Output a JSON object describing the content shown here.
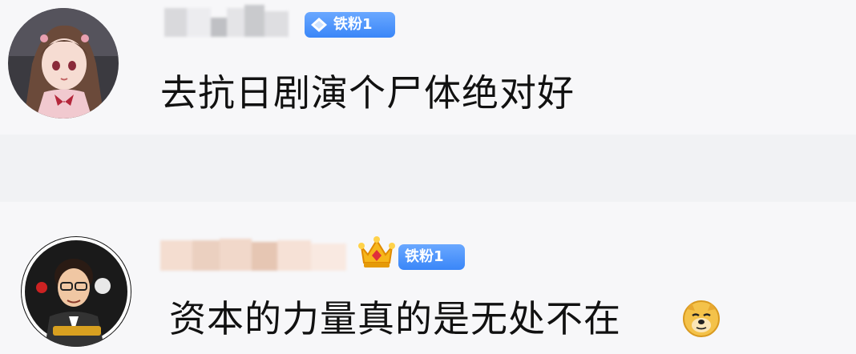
{
  "comments": [
    {
      "username_visible": false,
      "badge_label": "铁粉1",
      "badge_icon": "diamond-icon",
      "text": "去抗日剧演个尸体绝对好"
    },
    {
      "username_visible": false,
      "badge_label": "铁粉1",
      "badge_icon": "crown-icon",
      "text": "资本的力量真的是无处不在",
      "trailing_emoji": "doge-emoji"
    }
  ],
  "colors": {
    "badge_blue": "#3a86f8",
    "background": "#f4f5f7",
    "text": "#111111"
  }
}
